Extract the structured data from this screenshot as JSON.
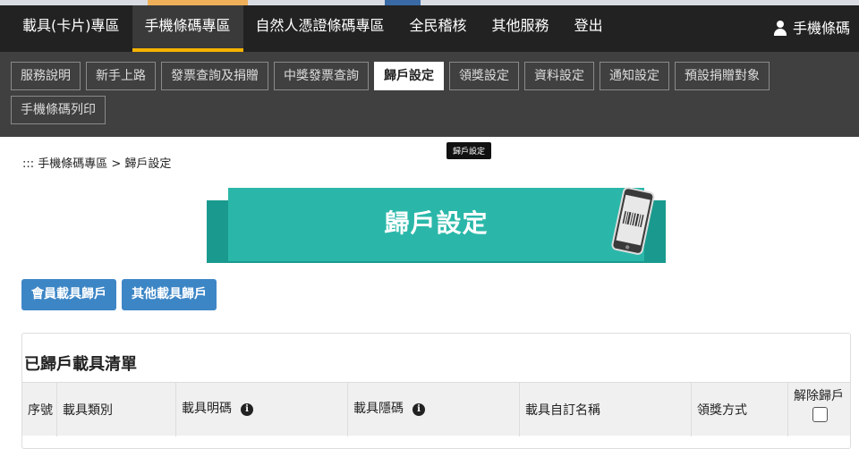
{
  "nav": {
    "items": [
      {
        "label": "載具(卡片)專區"
      },
      {
        "label": "手機條碼專區"
      },
      {
        "label": "自然人憑證條碼專區"
      },
      {
        "label": "全民稽核"
      },
      {
        "label": "其他服務"
      },
      {
        "label": "登出"
      }
    ],
    "active_index": 1,
    "user_label": "手機條碼"
  },
  "subnav": {
    "items": [
      {
        "label": "服務說明"
      },
      {
        "label": "新手上路"
      },
      {
        "label": "發票查詢及捐贈"
      },
      {
        "label": "中獎發票查詢"
      },
      {
        "label": "歸戶設定"
      },
      {
        "label": "領獎設定"
      },
      {
        "label": "資料設定"
      },
      {
        "label": "通知設定"
      },
      {
        "label": "預設捐贈對象"
      },
      {
        "label": "手機條碼列印"
      }
    ],
    "active_index": 4,
    "tooltip": "歸戶設定"
  },
  "breadcrumb": "::: 手機條碼專區 > 歸戶設定",
  "banner": {
    "title": "歸戶設定"
  },
  "tabs": [
    {
      "label": "會員載具歸戶"
    },
    {
      "label": "其他載具歸戶"
    }
  ],
  "panel": {
    "title": "已歸戶載具清單",
    "columns": [
      "序號",
      "載具類別",
      "載具明碼",
      "載具隱碼",
      "載具自訂名稱",
      "領獎方式",
      "解除歸戶"
    ]
  },
  "colors": {
    "nav_bg": "#222222",
    "accent": "#f5b400",
    "teal": "#2ab7a9",
    "button_blue": "#3d86c6"
  }
}
